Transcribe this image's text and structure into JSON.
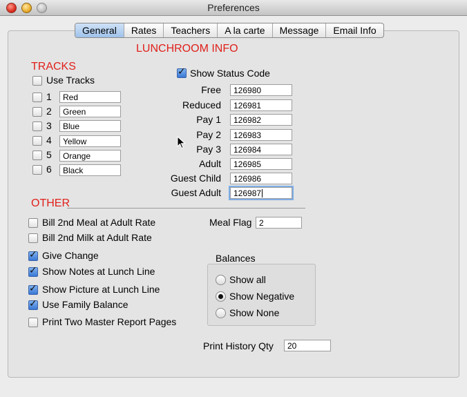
{
  "window": {
    "title": "Preferences"
  },
  "tabs": [
    "General",
    "Rates",
    "Teachers",
    "A la carte",
    "Message",
    "Email Info"
  ],
  "headings": {
    "lunchroom": "LUNCHROOM INFO",
    "tracks": "TRACKS",
    "other": "OTHER"
  },
  "tracks": {
    "use_tracks_label": "Use Tracks",
    "items": [
      {
        "num": "1",
        "value": "Red"
      },
      {
        "num": "2",
        "value": "Green"
      },
      {
        "num": "3",
        "value": "Blue"
      },
      {
        "num": "4",
        "value": "Yellow"
      },
      {
        "num": "5",
        "value": "Orange"
      },
      {
        "num": "6",
        "value": "Black"
      }
    ]
  },
  "status": {
    "show_status_code_label": "Show Status Code",
    "codes": [
      {
        "label": "Free",
        "value": "126980"
      },
      {
        "label": "Reduced",
        "value": "126981"
      },
      {
        "label": "Pay 1",
        "value": "126982"
      },
      {
        "label": "Pay 2",
        "value": "126983"
      },
      {
        "label": "Pay 3",
        "value": "126984"
      },
      {
        "label": "Adult",
        "value": "126985"
      },
      {
        "label": "Guest Child",
        "value": "126986"
      },
      {
        "label": "Guest Adult",
        "value": "126987"
      }
    ]
  },
  "other": {
    "options": [
      {
        "label": "Bill 2nd Meal at Adult Rate",
        "checked": false
      },
      {
        "label": "Bill 2nd Milk at  Adult Rate",
        "checked": false
      },
      {
        "label": "Give Change",
        "checked": true
      },
      {
        "label": "Show Notes at Lunch Line",
        "checked": true
      },
      {
        "label": "Show Picture at Lunch Line",
        "checked": true
      },
      {
        "label": "Use Family Balance",
        "checked": true
      },
      {
        "label": "Print Two Master Report Pages",
        "checked": false
      }
    ],
    "meal_flag_label": "Meal Flag",
    "meal_flag_value": "2",
    "balances_label": "Balances",
    "balances_options": [
      "Show all",
      "Show Negative",
      "Show None"
    ],
    "balances_selected": "Show Negative",
    "print_history_label": "Print History Qty",
    "print_history_value": "20"
  },
  "colors": {
    "heading_red": "#e0201a",
    "tab_active": "#9fc2ea",
    "check_blue": "#3a78d6"
  }
}
